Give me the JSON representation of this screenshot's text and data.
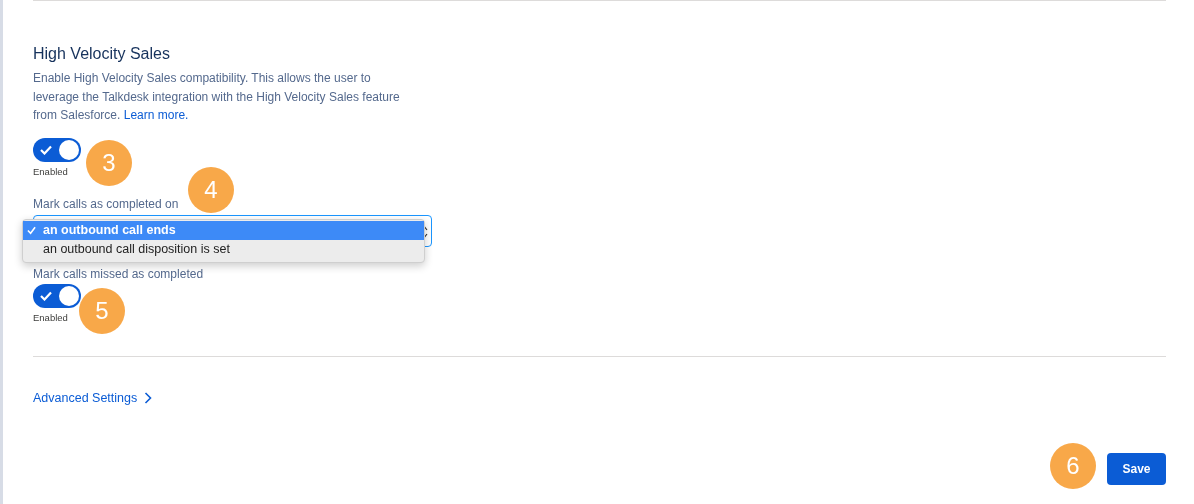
{
  "section": {
    "title": "High Velocity Sales",
    "description": "Enable High Velocity Sales compatibility. This allows the user to leverage the Talkdesk integration with the High Velocity Sales feature from Salesforce.",
    "learn_more": "Learn more."
  },
  "hvs_toggle": {
    "on": true,
    "caption": "Enabled"
  },
  "completed_on": {
    "label": "Mark calls as completed on",
    "options": [
      {
        "label": "an outbound call ends",
        "selected": true
      },
      {
        "label": "an outbound call disposition is set",
        "selected": false
      }
    ]
  },
  "missed_toggle": {
    "label": "Mark calls missed as completed",
    "on": true,
    "caption": "Enabled"
  },
  "advanced_settings": "Advanced Settings",
  "save_button": "Save",
  "badges": [
    {
      "label": "3"
    },
    {
      "label": "4"
    },
    {
      "label": "5"
    },
    {
      "label": "6"
    }
  ]
}
